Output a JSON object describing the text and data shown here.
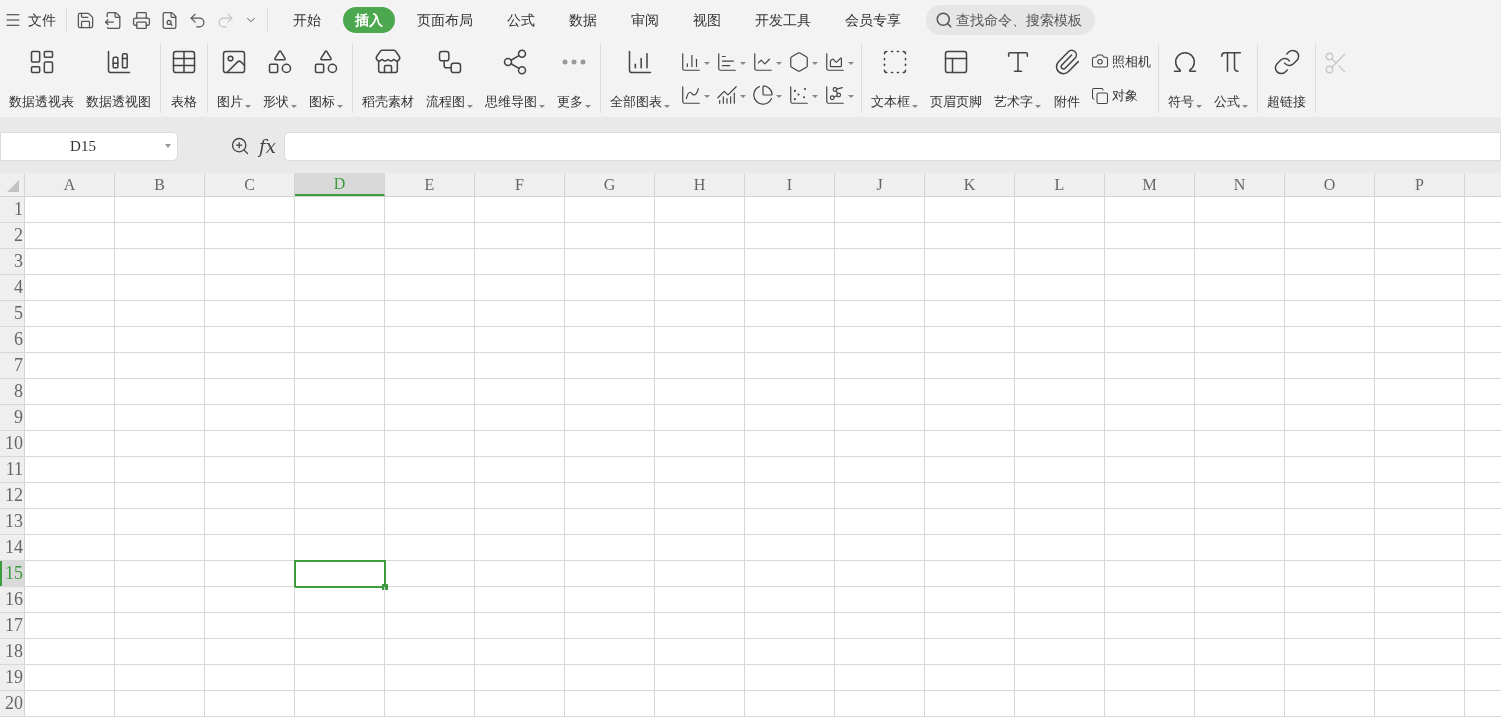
{
  "menu_button": {
    "label": "文件"
  },
  "tabs": [
    {
      "label": "开始",
      "selected": false
    },
    {
      "label": "插入",
      "selected": true
    },
    {
      "label": "页面布局",
      "selected": false
    },
    {
      "label": "公式",
      "selected": false
    },
    {
      "label": "数据",
      "selected": false
    },
    {
      "label": "审阅",
      "selected": false
    },
    {
      "label": "视图",
      "selected": false
    },
    {
      "label": "开发工具",
      "selected": false
    },
    {
      "label": "会员专享",
      "selected": false
    }
  ],
  "search": {
    "placeholder": "查找命令、搜索模板"
  },
  "ribbon": {
    "groups": [
      {
        "items": [
          {
            "kind": "large",
            "label": "数据透视表",
            "dropdown": false
          },
          {
            "kind": "large",
            "label": "数据透视图",
            "dropdown": false
          }
        ]
      },
      {
        "items": [
          {
            "kind": "large",
            "label": "表格",
            "dropdown": false
          }
        ]
      },
      {
        "items": [
          {
            "kind": "large",
            "label": "图片",
            "dropdown": true
          },
          {
            "kind": "large",
            "label": "形状",
            "dropdown": true
          },
          {
            "kind": "large",
            "label": "图标",
            "dropdown": true
          }
        ]
      },
      {
        "items": [
          {
            "kind": "large",
            "label": "稻壳素材",
            "dropdown": false
          },
          {
            "kind": "large",
            "label": "流程图",
            "dropdown": true
          },
          {
            "kind": "large",
            "label": "思维导图",
            "dropdown": true
          },
          {
            "kind": "large",
            "label": "更多",
            "dropdown": true
          }
        ]
      },
      {
        "items": [
          {
            "kind": "large",
            "label": "全部图表",
            "dropdown": true
          },
          {
            "kind": "chart-grid"
          }
        ]
      },
      {
        "items": [
          {
            "kind": "large",
            "label": "文本框",
            "dropdown": true
          },
          {
            "kind": "large",
            "label": "页眉页脚",
            "dropdown": false
          },
          {
            "kind": "large",
            "label": "艺术字",
            "dropdown": true
          },
          {
            "kind": "large",
            "label": "附件",
            "dropdown": false
          },
          {
            "kind": "small",
            "label": "照相机",
            "dropdown": false
          },
          {
            "kind": "small",
            "label": "对象",
            "dropdown": false
          }
        ]
      },
      {
        "items": [
          {
            "kind": "large",
            "label": "符号",
            "dropdown": true
          },
          {
            "kind": "large",
            "label": "公式",
            "dropdown": true
          }
        ]
      },
      {
        "items": [
          {
            "kind": "large",
            "label": "超链接",
            "dropdown": false
          }
        ]
      },
      {
        "items": [
          {
            "kind": "cut-off",
            "disabled": true
          }
        ]
      }
    ]
  },
  "formula_bar": {
    "cell_ref": "D15",
    "fx_label": "fx"
  },
  "sheet": {
    "columns": [
      {
        "label": "A",
        "selected": false
      },
      {
        "label": "B",
        "selected": false
      },
      {
        "label": "C",
        "selected": false
      },
      {
        "label": "D",
        "selected": true
      },
      {
        "label": "E",
        "selected": false
      },
      {
        "label": "F",
        "selected": false
      },
      {
        "label": "G",
        "selected": false
      },
      {
        "label": "H",
        "selected": false
      },
      {
        "label": "I",
        "selected": false
      },
      {
        "label": "J",
        "selected": false
      },
      {
        "label": "K",
        "selected": false
      },
      {
        "label": "L",
        "selected": false
      },
      {
        "label": "M",
        "selected": false
      },
      {
        "label": "N",
        "selected": false
      },
      {
        "label": "O",
        "selected": false
      },
      {
        "label": "P",
        "selected": false
      }
    ],
    "rows": [
      {
        "label": "1",
        "selected": false
      },
      {
        "label": "2",
        "selected": false
      },
      {
        "label": "3",
        "selected": false
      },
      {
        "label": "4",
        "selected": false
      },
      {
        "label": "5",
        "selected": false
      },
      {
        "label": "6",
        "selected": false
      },
      {
        "label": "7",
        "selected": false
      },
      {
        "label": "8",
        "selected": false
      },
      {
        "label": "9",
        "selected": false
      },
      {
        "label": "10",
        "selected": false
      },
      {
        "label": "11",
        "selected": false
      },
      {
        "label": "12",
        "selected": false
      },
      {
        "label": "13",
        "selected": false
      },
      {
        "label": "14",
        "selected": false
      },
      {
        "label": "15",
        "selected": true
      },
      {
        "label": "16",
        "selected": false
      },
      {
        "label": "17",
        "selected": false
      },
      {
        "label": "18",
        "selected": false
      },
      {
        "label": "19",
        "selected": false
      },
      {
        "label": "20",
        "selected": false
      }
    ]
  }
}
